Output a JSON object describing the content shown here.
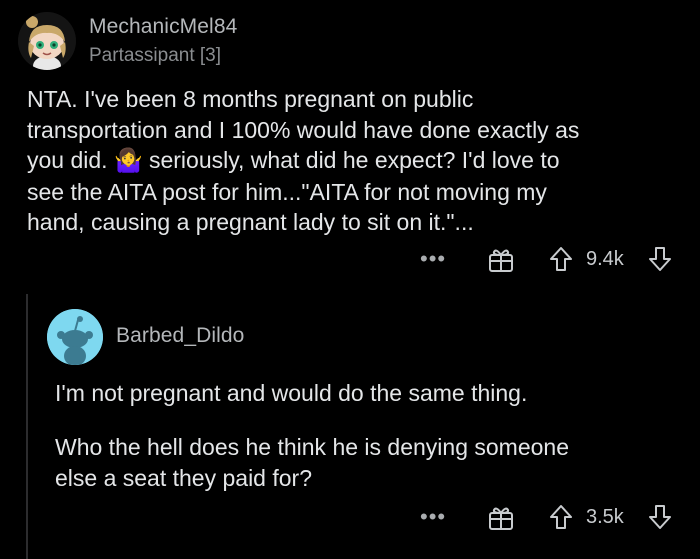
{
  "comment1": {
    "username": "MechanicMel84",
    "flair": "Partassipant [3]",
    "body_part1": "NTA. I've been 8 months pregnant on public\ntransportation and I 100% would have done exactly as\nyou did. ",
    "emoji": "🤷‍♀️",
    "body_part2": " seriously, what did he expect? I'd love to\nsee the AITA post for him...\"AITA for not moving my\nhand, causing a pregnant lady to sit on it.\"...",
    "more_label": "•••",
    "score": "9.4k",
    "icons": [
      "more-icon",
      "award-icon",
      "upvote-icon",
      "downvote-icon"
    ]
  },
  "comment2": {
    "username": "Barbed_Dildo",
    "paragraph1": "I'm not pregnant and would do the same thing.",
    "paragraph2": "Who the hell does he think he is denying someone\nelse a seat they paid for?",
    "more_label": "•••",
    "score": "3.5k",
    "icons": [
      "more-icon",
      "award-icon",
      "upvote-icon",
      "downvote-icon"
    ]
  },
  "colors": {
    "background": "#000000",
    "text": "#e4e6e8",
    "muted": "#8a8d90",
    "avatar2_bg": "#7ed8f0"
  }
}
